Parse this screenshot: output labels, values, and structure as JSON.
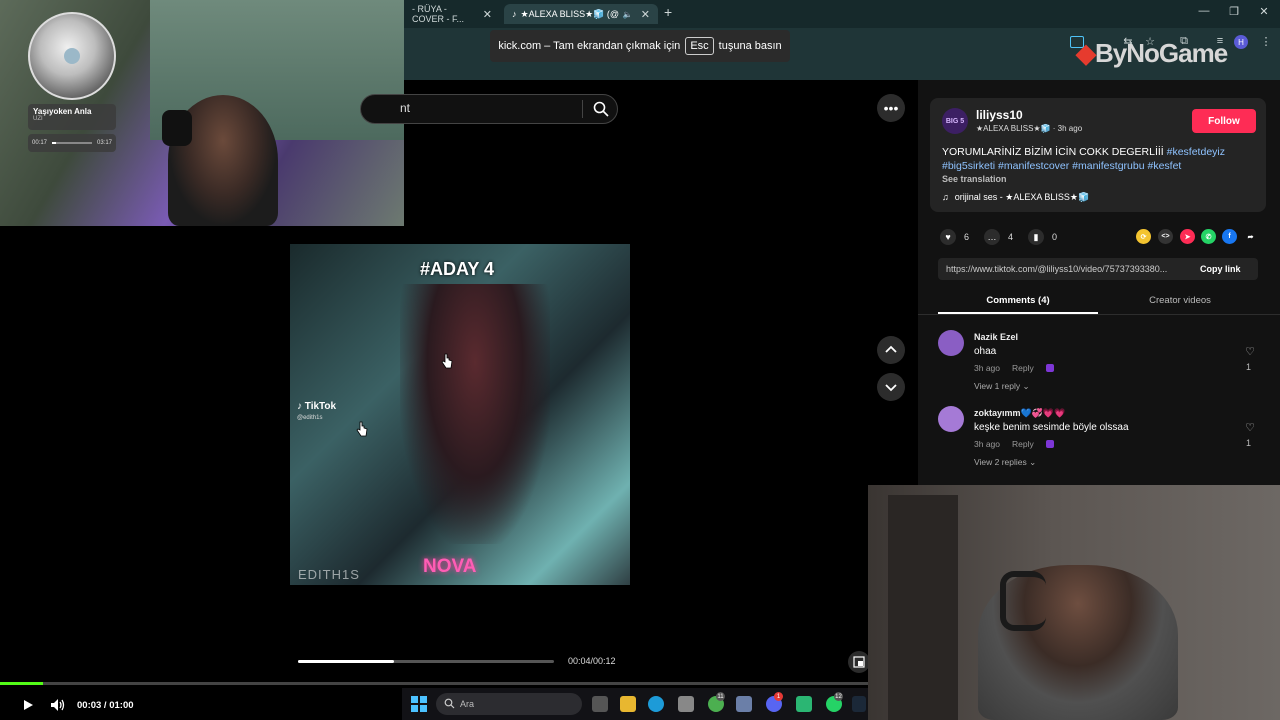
{
  "browser": {
    "tabs": [
      {
        "title": "- RÜYA - COVER - F..."
      },
      {
        "title": "★ALEXA BLISS★🧊 (@liliyss1..."
      }
    ],
    "new_tab_label": "+",
    "fullscreen_notice": {
      "prefix": "kick.com – Tam ekrandan çıkmak için",
      "key": "Esc",
      "suffix": "tuşuna basın"
    },
    "profile_initial": "H",
    "brand_watermark": "ByNoGame"
  },
  "music_widget": {
    "title": "Yaşıyoken Anla",
    "artist": "UZI",
    "elapsed": "00:17",
    "duration": "03:17",
    "progress": 0.09
  },
  "tiktok": {
    "search_placeholder": "nt",
    "video": {
      "overlay_title": "#ADAY 4",
      "overlay_name": "NOVA",
      "watermark": "TikTok",
      "watermark_handle": "@edith1s",
      "edith_mark": "EDITH1S",
      "time": "00:04/00:12",
      "progress": 0.375
    },
    "post": {
      "avatar_text": "BIG 5",
      "username": "liliyss10",
      "display_name": "★ALEXA BLISS★🧊",
      "time_ago": "3h ago",
      "follow_label": "Follow",
      "caption_text": "YORUMLARİNİZ BİZİM İCİN COKK DEGERLİİİ",
      "hashtags": [
        "#kesfetdeyiz",
        "#big5sirketi",
        "#manifestcover",
        "#manifestgrubu",
        "#kesfet"
      ],
      "see_translation": "See translation",
      "music": "orijinal ses - ★ALEXA BLISS★🧊",
      "likes": "6",
      "comments": "4",
      "saves": "0",
      "link": "https://www.tiktok.com/@liliyss10/video/75737393380...",
      "copy_link_label": "Copy link"
    },
    "tabs": {
      "comments": "Comments (4)",
      "creator_videos": "Creator videos"
    },
    "comment_list": [
      {
        "user": "Nazik Ezel",
        "text": "ohaa",
        "time": "3h ago",
        "reply": "Reply",
        "view_replies": "View 1 reply",
        "likes": "1",
        "avatar_color": "#8a5ec4"
      },
      {
        "user": "zoktayımm💙💞💗💗",
        "text": "keşke benim sesimde böyle olssaa",
        "time": "3h ago",
        "reply": "Reply",
        "view_replies": "View 2 replies",
        "likes": "1",
        "avatar_color": "#a57ad6"
      }
    ]
  },
  "player": {
    "time": "00:03 / 01:00",
    "progress": 0.05
  },
  "taskbar": {
    "search_text": "Ara",
    "badges": [
      "11",
      "1",
      "12"
    ]
  },
  "colors": {
    "follow": "#fe2c55",
    "kick_green": "#53fc18",
    "hashtag": "#8fc3ff"
  }
}
